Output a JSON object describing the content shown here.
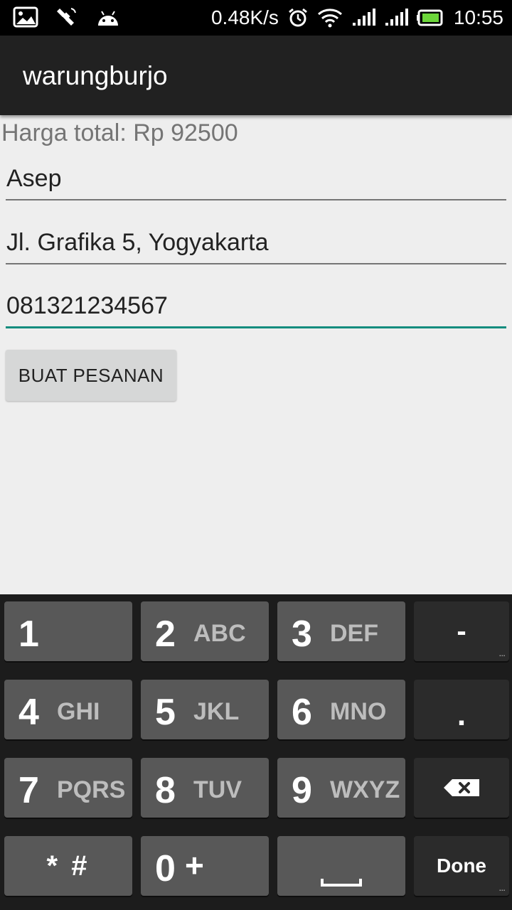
{
  "status_bar": {
    "net_speed": "0.48K/s",
    "time": "10:55",
    "battery_color": "#6cd63a"
  },
  "app": {
    "title": "warungburjo"
  },
  "form": {
    "total_label": "Harga total: Rp 92500",
    "name_value": "Asep",
    "address_value": "Jl. Grafika 5, Yogyakarta",
    "phone_value": "081321234567",
    "order_button": "BUAT PESANAN"
  },
  "keyboard": {
    "keys": [
      {
        "num": "1",
        "letters": ""
      },
      {
        "num": "2",
        "letters": "ABC"
      },
      {
        "num": "3",
        "letters": "DEF"
      },
      {
        "num": "4",
        "letters": "GHI"
      },
      {
        "num": "5",
        "letters": "JKL"
      },
      {
        "num": "6",
        "letters": "MNO"
      },
      {
        "num": "7",
        "letters": "PQRS"
      },
      {
        "num": "8",
        "letters": "TUV"
      },
      {
        "num": "9",
        "letters": "WXYZ"
      },
      {
        "num": "0",
        "letters": "+"
      }
    ],
    "star_hash": "* #",
    "minus": "-",
    "dot": ".",
    "done": "Done",
    "more_dots": "..."
  },
  "icons": [
    "gallery-icon",
    "satellite-icon",
    "android-icon",
    "alarm-icon",
    "wifi-icon",
    "signal-icon",
    "battery-icon",
    "backspace-icon",
    "space-icon"
  ],
  "accent_color": "#128c7e"
}
